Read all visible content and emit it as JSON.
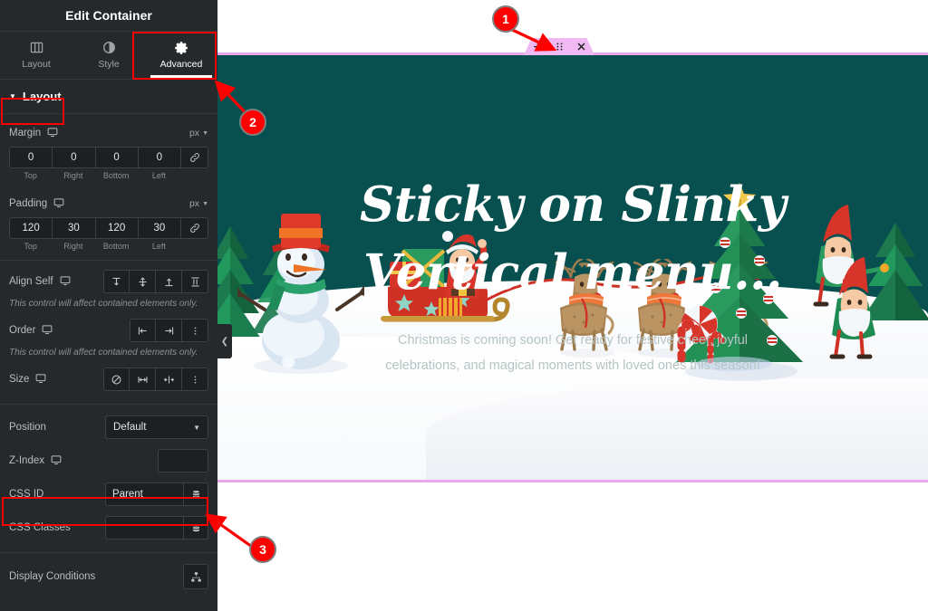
{
  "panel": {
    "title": "Edit Container",
    "tabs": [
      {
        "label": "Layout",
        "icon": "layout-columns-icon",
        "active": false
      },
      {
        "label": "Style",
        "icon": "contrast-circle-icon",
        "active": false
      },
      {
        "label": "Advanced",
        "icon": "gear-icon",
        "active": true
      }
    ],
    "section": {
      "label": "Layout",
      "expanded": true
    },
    "margin": {
      "label": "Margin",
      "unit": "px",
      "values": [
        "0",
        "0",
        "0",
        "0"
      ],
      "sides": [
        "Top",
        "Right",
        "Bottom",
        "Left"
      ],
      "link_icon": "link-icon"
    },
    "padding": {
      "label": "Padding",
      "unit": "px",
      "values": [
        "120",
        "30",
        "120",
        "30"
      ],
      "sides": [
        "Top",
        "Right",
        "Bottom",
        "Left"
      ],
      "link_icon": "link-icon"
    },
    "align_self": {
      "label": "Align Self",
      "note": "This control will affect contained elements only.",
      "options": [
        "align-start-icon",
        "align-center-icon",
        "align-end-icon",
        "align-stretch-icon"
      ]
    },
    "order": {
      "label": "Order",
      "note": "This control will affect contained elements only.",
      "options": [
        "order-start-icon",
        "order-end-icon",
        "more-vertical-icon"
      ]
    },
    "size": {
      "label": "Size",
      "options": [
        "none-icon",
        "grow-icon",
        "shrink-icon",
        "more-vertical-icon"
      ]
    },
    "position": {
      "label": "Position",
      "value": "Default",
      "icon": "chevron-down-icon"
    },
    "z_index": {
      "label": "Z-Index",
      "value": "",
      "placeholder": ""
    },
    "css_id": {
      "label": "CSS ID",
      "value": "Parent",
      "placeholder": "",
      "icon": "database-icon"
    },
    "css_classes": {
      "label": "CSS Classes",
      "value": "",
      "placeholder": "",
      "icon": "database-icon"
    },
    "display_conditions": {
      "label": "Display Conditions",
      "icon": "sitemap-icon"
    },
    "responsive_icon": "desktop-icon",
    "collapse_handle_icon": "chevron-left-icon"
  },
  "canvas": {
    "toolbar": {
      "add_icon": "plus-icon",
      "drag_icon": "drag-grid-icon",
      "close_icon": "close-icon",
      "bg_color": "#f0b9f3"
    },
    "hero": {
      "heading_line1": "Sticky on Slinky",
      "heading_line2": "Vertical menu...",
      "paragraph": "Christmas is coming soon! Get ready for festive cheer, joyful celebrations, and magical moments with loved ones this season!",
      "bg_color": "#07504f",
      "border_color": "#eba7ec",
      "heading_color": "#ffffff",
      "paragraph_color": "#b6c5c4"
    },
    "scene": {
      "snowman": "snowman-illustration",
      "santa_sleigh": "santa-sleigh-illustration",
      "reindeer_count": 3,
      "christmas_tree": "christmas-tree-illustration",
      "gnomes": "gnome-elves-illustration",
      "pine_trees": "pine-trees-illustration"
    }
  },
  "annotations": {
    "markers": [
      {
        "number": "1",
        "target": "widget-toolbar"
      },
      {
        "number": "2",
        "target": "advanced-tab"
      },
      {
        "number": "3",
        "target": "css-id-field"
      }
    ],
    "color": "#ff0000"
  }
}
